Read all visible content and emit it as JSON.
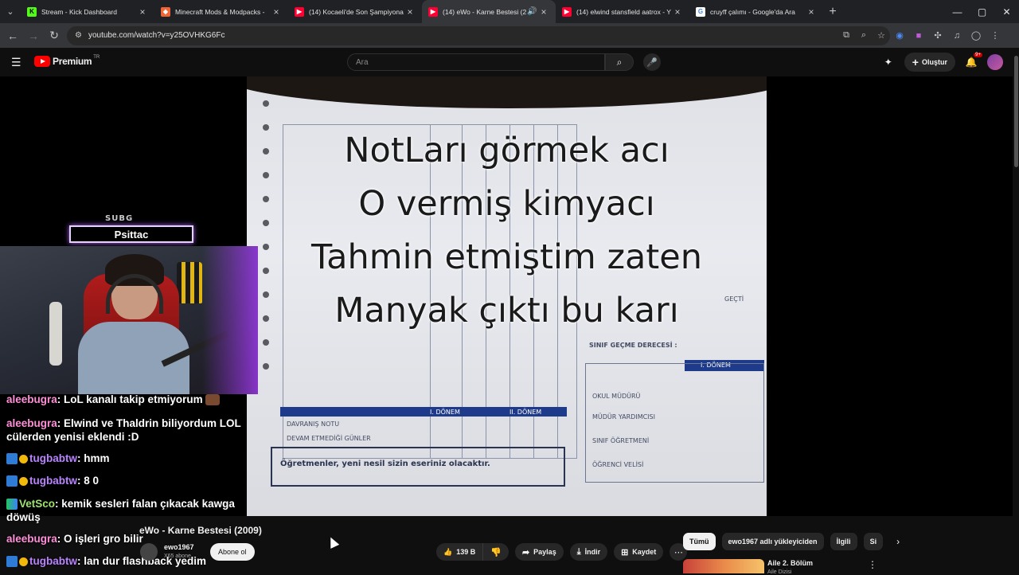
{
  "browser": {
    "tabs": [
      {
        "title": "Stream - Kick Dashboard",
        "favicon": "kick-icon",
        "color": "#53fc18"
      },
      {
        "title": "Minecraft Mods & Modpacks -",
        "favicon": "curseforge-icon",
        "color": "#f16436"
      },
      {
        "title": "(14) Kocaeli'de Son Şampiyona",
        "favicon": "youtube-icon",
        "color": "#ff0033"
      },
      {
        "title": "(14) eWo - Karne Bestesi (2",
        "favicon": "youtube-icon",
        "color": "#ff0033",
        "active": true
      },
      {
        "title": "(14) elwind stansfield aatrox - Y",
        "favicon": "youtube-icon",
        "color": "#ff0033"
      },
      {
        "title": "cruyff çalımı - Google'da Ara",
        "favicon": "google-icon",
        "color": "#4285f4"
      }
    ],
    "url": "youtube.com/watch?v=y25OVHKG6Fc"
  },
  "youtube": {
    "brand": "Premium",
    "country": "TR",
    "search_placeholder": "Ara",
    "create_label": "Oluştur",
    "notifications": "9+"
  },
  "video": {
    "lyrics": [
      "NotLarı görmek acı",
      "O vermiş kimyacı",
      "Tahmin etmiştim zaten",
      "Manyak çıktı bu karı"
    ],
    "paper_text": {
      "footer": "Öğretmenler, yeni nesil sizin eseriniz olacaktır.",
      "signature_title": "SINIF GEÇME DERECESİ :",
      "gecti": "GEÇTİ",
      "term": "I. DÖNEM",
      "term2": "II. DÖNEM",
      "davranis": "DAVRANIŞ NOTU",
      "devam": "DEVAM ETMEDİĞİ GÜNLER",
      "okul": "OKUL MÜDÜRÜ",
      "mudur": "MÜDÜR YARDIMCISI",
      "sinif": "SINIF ÖĞRETMENİ",
      "veli": "ÖĞRENCİ VELİSİ"
    },
    "title": "eWo - Karne Bestesi (2009)",
    "channel": "ewo1967",
    "subscribers": "X65 abone",
    "subscribe_label": "Abone ol",
    "likes": "139 B",
    "share_label": "Paylaş",
    "download_label": "İndir",
    "save_label": "Kaydet"
  },
  "stream_overlay": {
    "sub_badge": "SUBG",
    "sub_name": "Psittac"
  },
  "chat": [
    {
      "user": "aleebugra",
      "text": "LoL kanalı takip etmiyorum",
      "badges": []
    },
    {
      "user": "aleebugra",
      "text": "Elwind ve Thaldrin biliyordum LOL cülerden yenisi eklendi :D",
      "badges": []
    },
    {
      "user": "tugbabtw",
      "text": "hmm",
      "badges": [
        "prime",
        "coin"
      ]
    },
    {
      "user": "tugbabtw",
      "text": "8 0",
      "badges": [
        "prime",
        "coin"
      ]
    },
    {
      "user": "VetSco",
      "text": "kemik sesleri falan çıkacak kawga döwüş",
      "badges": [
        "vip"
      ]
    },
    {
      "user": "aleebugra",
      "text": "O işleri gro bilir",
      "badges": []
    },
    {
      "user": "tugbabtw",
      "text": "lan dur flashback yedim",
      "badges": [
        "prime",
        "coin"
      ]
    }
  ],
  "chips": [
    "Tümü",
    "ewo1967 adlı yükleyiciden",
    "İlgili",
    "Si"
  ],
  "recommended": {
    "title": "Aile 2. Bölüm",
    "channel": "Aile Dizisi"
  }
}
